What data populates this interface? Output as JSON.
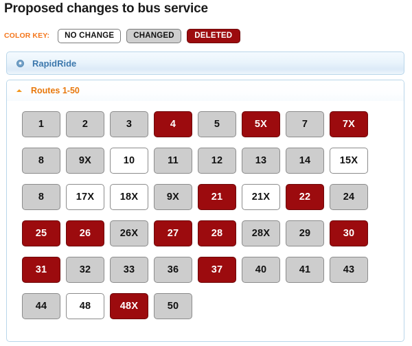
{
  "page_title": "Proposed changes to bus service",
  "color_key": {
    "label": "COLOR KEY:",
    "items": [
      {
        "label": "NO CHANGE",
        "status": "no_change",
        "color": "#ffffff"
      },
      {
        "label": "CHANGED",
        "status": "changed",
        "color": "#cdcdcd"
      },
      {
        "label": "DELETED",
        "status": "deleted",
        "color": "#9c0b0e"
      }
    ]
  },
  "accent_colors": {
    "orange": "#e8780c",
    "key_orange": "#f4761b",
    "panel_blue_border": "#b9d6ea",
    "header_blue_text": "#3c78ad",
    "deleted_red": "#9c0b0e",
    "changed_gray": "#cdcdcd"
  },
  "sections": [
    {
      "title": "RapidRide",
      "expanded": false,
      "toggle_icon": "disc-icon"
    },
    {
      "title": "Routes 1-50",
      "expanded": true,
      "toggle_icon": "caret-up-icon",
      "rows": [
        [
          {
            "label": "1",
            "status": "changed"
          },
          {
            "label": "2",
            "status": "changed"
          },
          {
            "label": "3",
            "status": "changed"
          },
          {
            "label": "4",
            "status": "deleted"
          },
          {
            "label": "5",
            "status": "changed"
          },
          {
            "label": "5X",
            "status": "deleted"
          },
          {
            "label": "7",
            "status": "changed"
          },
          {
            "label": "7X",
            "status": "deleted"
          }
        ],
        [
          {
            "label": "8",
            "status": "changed"
          },
          {
            "label": "9X",
            "status": "changed"
          },
          {
            "label": "10",
            "status": "no_change"
          },
          {
            "label": "11",
            "status": "changed"
          },
          {
            "label": "12",
            "status": "changed"
          },
          {
            "label": "13",
            "status": "changed"
          },
          {
            "label": "14",
            "status": "changed"
          },
          {
            "label": "15X",
            "status": "no_change"
          }
        ],
        [
          {
            "label": "8",
            "status": "changed"
          },
          {
            "label": "17X",
            "status": "no_change"
          },
          {
            "label": "18X",
            "status": "no_change"
          },
          {
            "label": "9X",
            "status": "changed"
          },
          {
            "label": "21",
            "status": "deleted"
          },
          {
            "label": "21X",
            "status": "no_change"
          },
          {
            "label": "22",
            "status": "deleted"
          },
          {
            "label": "24",
            "status": "changed"
          }
        ],
        [
          {
            "label": "25",
            "status": "deleted"
          },
          {
            "label": "26",
            "status": "deleted"
          },
          {
            "label": "26X",
            "status": "changed"
          },
          {
            "label": "27",
            "status": "deleted"
          },
          {
            "label": "28",
            "status": "deleted"
          },
          {
            "label": "28X",
            "status": "changed"
          },
          {
            "label": "29",
            "status": "changed"
          },
          {
            "label": "30",
            "status": "deleted"
          }
        ],
        [
          {
            "label": "31",
            "status": "deleted"
          },
          {
            "label": "32",
            "status": "changed"
          },
          {
            "label": "33",
            "status": "changed"
          },
          {
            "label": "36",
            "status": "changed"
          },
          {
            "label": "37",
            "status": "deleted"
          },
          {
            "label": "40",
            "status": "changed"
          },
          {
            "label": "41",
            "status": "changed"
          },
          {
            "label": "43",
            "status": "changed"
          }
        ],
        [
          {
            "label": "44",
            "status": "changed"
          },
          {
            "label": "48",
            "status": "no_change"
          },
          {
            "label": "48X",
            "status": "deleted"
          },
          {
            "label": "50",
            "status": "changed"
          }
        ]
      ]
    }
  ]
}
